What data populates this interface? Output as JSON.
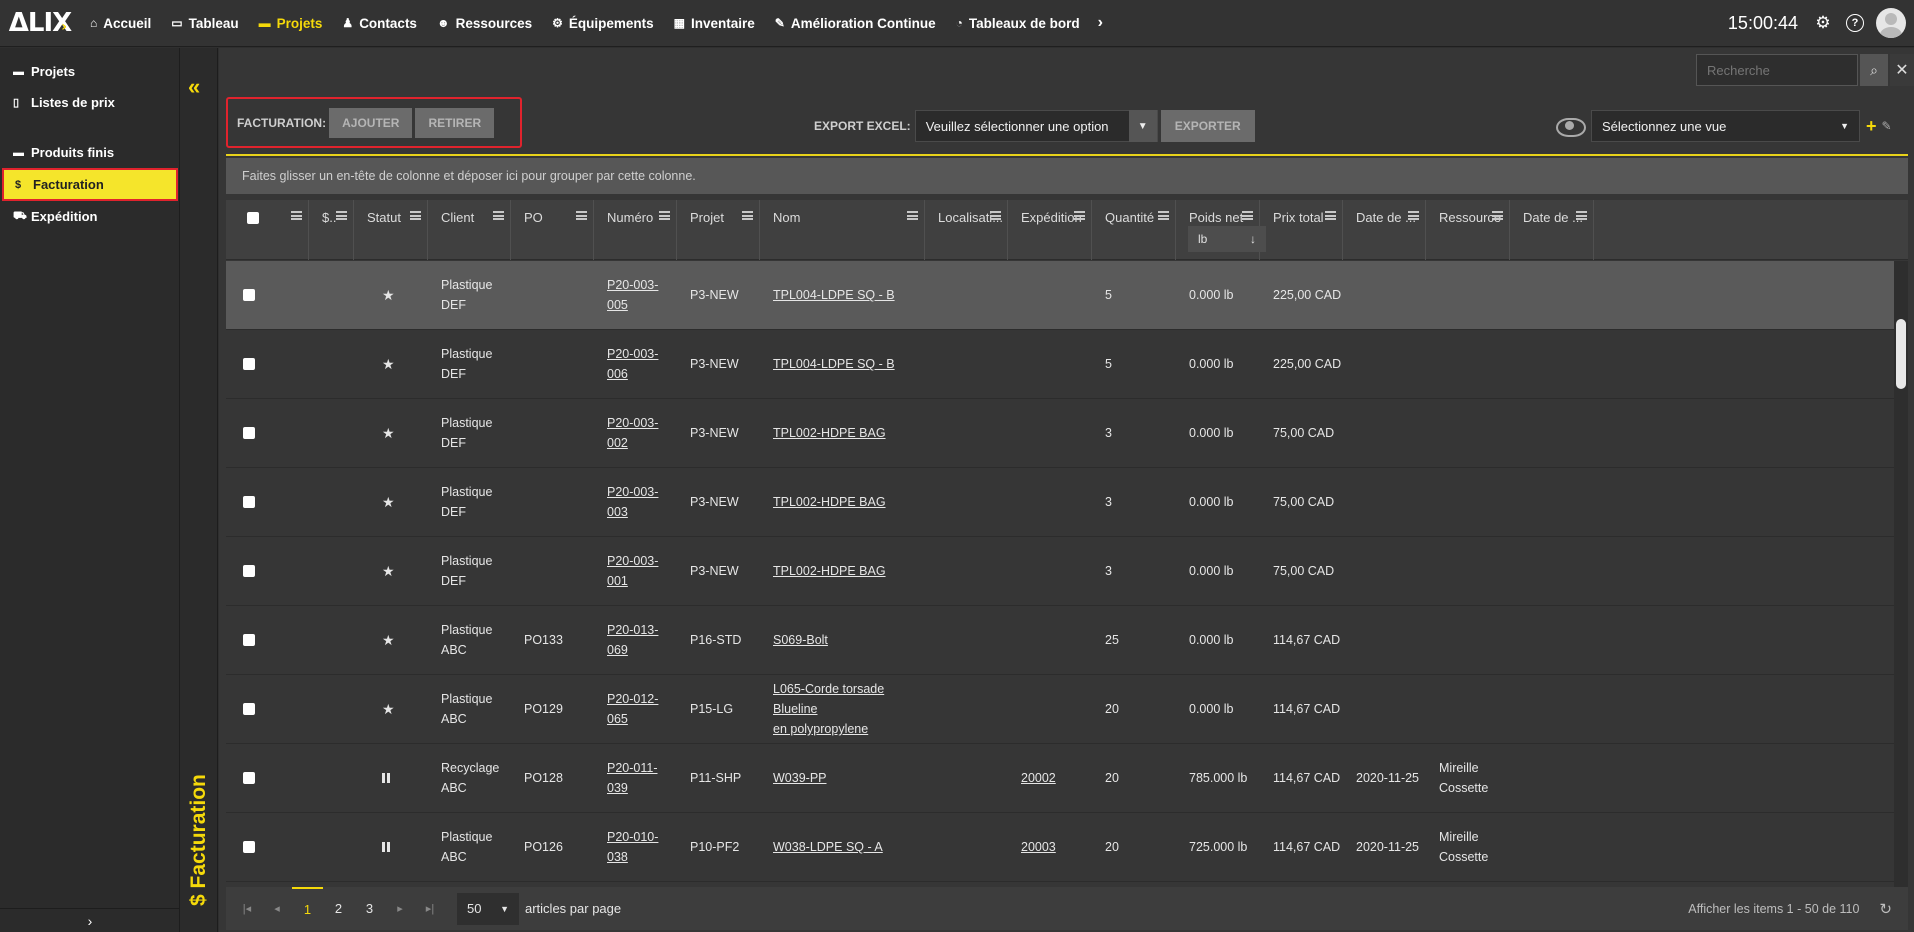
{
  "app": {
    "logo": "ΔLIX",
    "clock": "15:00:44"
  },
  "nav": [
    {
      "label": "Accueil",
      "icon": "home-icon",
      "glyph": "⌂"
    },
    {
      "label": "Tableau",
      "icon": "monitor-icon",
      "glyph": "▭"
    },
    {
      "label": "Projets",
      "icon": "folder-icon",
      "glyph": "▬",
      "active": true
    },
    {
      "label": "Contacts",
      "icon": "person-icon",
      "glyph": "♟"
    },
    {
      "label": "Ressources",
      "icon": "users-icon",
      "glyph": "☻"
    },
    {
      "label": "Équipements",
      "icon": "cogs-icon",
      "glyph": "⚙"
    },
    {
      "label": "Inventaire",
      "icon": "boxes-icon",
      "glyph": "▦"
    },
    {
      "label": "Amélioration Continue",
      "icon": "magic-icon",
      "glyph": "✎"
    },
    {
      "label": "Tableaux de bord",
      "icon": "dashboard-icon",
      "glyph": "◔"
    }
  ],
  "sidebar": {
    "items": [
      {
        "label": "Projets",
        "icon": "folder-icon",
        "glyph": "▬"
      },
      {
        "label": "Listes de prix",
        "icon": "file-icon",
        "glyph": "▯"
      },
      {
        "gap": true
      },
      {
        "label": "Produits finis",
        "icon": "folder-icon",
        "glyph": "▬"
      },
      {
        "label": "Facturation",
        "icon": "dollar-icon",
        "glyph": "$",
        "active": true
      },
      {
        "label": "Expédition",
        "icon": "truck-icon",
        "glyph": "⛟"
      }
    ]
  },
  "strip": {
    "title": "$ Facturation"
  },
  "search": {
    "placeholder": "Recherche"
  },
  "toolbar": {
    "facturation_label": "FACTURATION:",
    "ajouter": "AJOUTER",
    "retirer": "RETIRER",
    "export_label": "EXPORT EXCEL:",
    "export_select": "Veuillez sélectionner une option",
    "exporter": "EXPORTER",
    "view_select": "Sélectionnez une vue"
  },
  "grouping_hint": "Faites glisser un en-tête de colonne et déposer ici pour grouper par cette colonne.",
  "columns": [
    "",
    "$..",
    "Statut",
    "Client",
    "PO",
    "Numéro",
    "Projet",
    "Nom",
    "Localisati...",
    "Expédition",
    "Quantité",
    "Poids net",
    "Prix total",
    "Date de ...",
    "Ressource",
    "Date de ..."
  ],
  "weight_unit": "lb",
  "rows": [
    {
      "status": "star",
      "client": [
        "Plastique",
        "DEF"
      ],
      "po": "",
      "numero": [
        "P20-003-",
        "005"
      ],
      "projet": "P3-NEW",
      "nom": [
        "TPL004-LDPE SQ - B"
      ],
      "expedition": "",
      "quantite": "5",
      "poids": "0.000 lb",
      "prix": "225,00 CAD",
      "date": "",
      "ressource": [
        "",
        ""
      ],
      "highlight": true
    },
    {
      "status": "star",
      "client": [
        "Plastique",
        "DEF"
      ],
      "po": "",
      "numero": [
        "P20-003-",
        "006"
      ],
      "projet": "P3-NEW",
      "nom": [
        "TPL004-LDPE SQ - B"
      ],
      "expedition": "",
      "quantite": "5",
      "poids": "0.000 lb",
      "prix": "225,00 CAD",
      "date": "",
      "ressource": [
        "",
        ""
      ]
    },
    {
      "status": "star",
      "client": [
        "Plastique",
        "DEF"
      ],
      "po": "",
      "numero": [
        "P20-003-",
        "002"
      ],
      "projet": "P3-NEW",
      "nom": [
        "TPL002-HDPE BAG"
      ],
      "expedition": "",
      "quantite": "3",
      "poids": "0.000 lb",
      "prix": "75,00 CAD",
      "date": "",
      "ressource": [
        "",
        ""
      ]
    },
    {
      "status": "star",
      "client": [
        "Plastique",
        "DEF"
      ],
      "po": "",
      "numero": [
        "P20-003-",
        "003"
      ],
      "projet": "P3-NEW",
      "nom": [
        "TPL002-HDPE BAG"
      ],
      "expedition": "",
      "quantite": "3",
      "poids": "0.000 lb",
      "prix": "75,00 CAD",
      "date": "",
      "ressource": [
        "",
        ""
      ]
    },
    {
      "status": "star",
      "client": [
        "Plastique",
        "DEF"
      ],
      "po": "",
      "numero": [
        "P20-003-",
        "001"
      ],
      "projet": "P3-NEW",
      "nom": [
        "TPL002-HDPE BAG"
      ],
      "expedition": "",
      "quantite": "3",
      "poids": "0.000 lb",
      "prix": "75,00 CAD",
      "date": "",
      "ressource": [
        "",
        ""
      ]
    },
    {
      "status": "star",
      "client": [
        "Plastique",
        "ABC"
      ],
      "po": "PO133",
      "numero": [
        "P20-013-",
        "069"
      ],
      "projet": "P16-STD",
      "nom": [
        "S069-Bolt"
      ],
      "expedition": "",
      "quantite": "25",
      "poids": "0.000 lb",
      "prix": "114,67 CAD",
      "date": "",
      "ressource": [
        "",
        ""
      ]
    },
    {
      "status": "star",
      "client": [
        "Plastique",
        "ABC"
      ],
      "po": "PO129",
      "numero": [
        "P20-012-",
        "065"
      ],
      "projet": "P15-LG",
      "nom": [
        "L065-Corde torsade Blueline",
        "en polypropylene"
      ],
      "expedition": "",
      "quantite": "20",
      "poids": "0.000 lb",
      "prix": "114,67 CAD",
      "date": "",
      "ressource": [
        "",
        ""
      ]
    },
    {
      "status": "pause",
      "client": [
        "Recyclage",
        "ABC"
      ],
      "po": "PO128",
      "numero": [
        "P20-011-",
        "039"
      ],
      "projet": "P11-SHP",
      "nom": [
        "W039-PP"
      ],
      "expedition": "20002",
      "quantite": "20",
      "poids": "785.000 lb",
      "prix": "114,67 CAD",
      "date": "2020-11-25",
      "ressource": [
        "Mireille",
        "Cossette"
      ]
    },
    {
      "status": "pause",
      "client": [
        "Plastique",
        "ABC"
      ],
      "po": "PO126",
      "numero": [
        "P20-010-",
        "038"
      ],
      "projet": "P10-PF2",
      "nom": [
        "W038-LDPE SQ - A"
      ],
      "expedition": "20003",
      "quantite": "20",
      "poids": "725.000 lb",
      "prix": "114,67 CAD",
      "date": "2020-11-25",
      "ressource": [
        "Mireille",
        "Cossette"
      ]
    }
  ],
  "pager": {
    "pages": [
      "1",
      "2",
      "3"
    ],
    "current": "1",
    "page_size": "50",
    "page_size_label": "articles par page",
    "info": "Afficher les items 1 - 50 de 110"
  }
}
